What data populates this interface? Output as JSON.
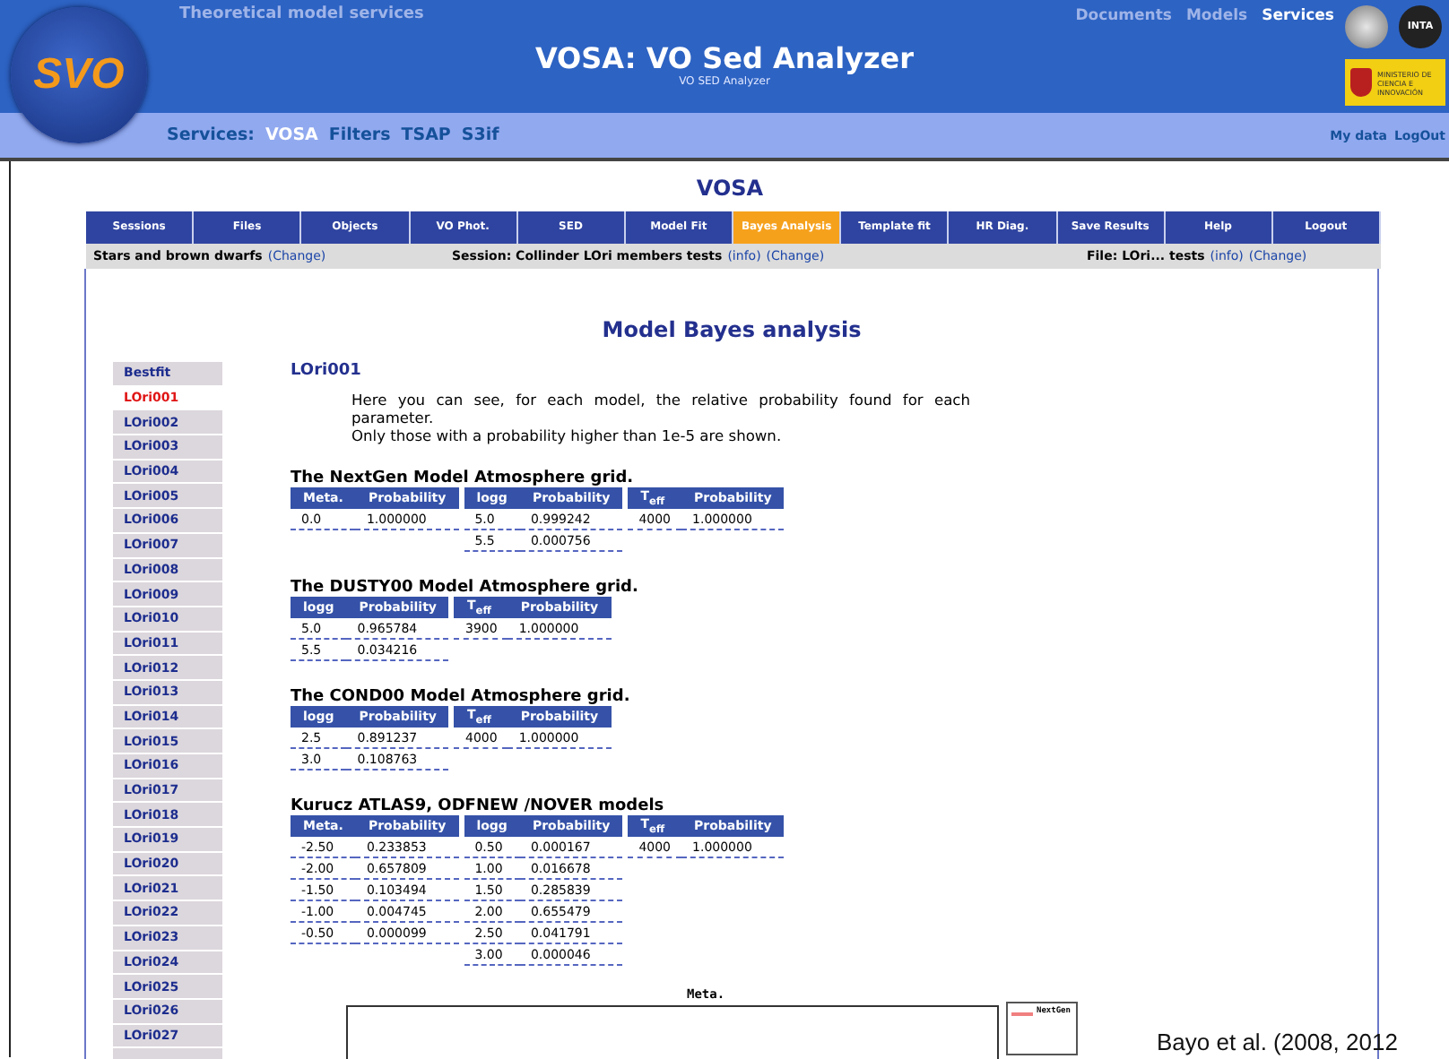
{
  "header": {
    "section_title": "Theoretical model services",
    "top_links": [
      {
        "label": "Documents",
        "selected": false
      },
      {
        "label": "Models",
        "selected": false
      },
      {
        "label": "Services",
        "selected": true
      }
    ],
    "title": "VOSA: VO Sed Analyzer",
    "subtitle": "VO SED Analyzer",
    "logo": "SVO",
    "partner_logo": "INTA",
    "ministry": "MINISTERIO DE CIENCIA E INNOVACIÓN"
  },
  "services_bar": {
    "label": "Services:",
    "links": [
      {
        "label": "VOSA",
        "selected": true
      },
      {
        "label": "Filters",
        "selected": false
      },
      {
        "label": "TSAP",
        "selected": false
      },
      {
        "label": "S3if",
        "selected": false
      }
    ],
    "user_links": [
      "My data",
      "LogOut"
    ]
  },
  "app_title": "VOSA",
  "tabs": [
    {
      "label": "Sessions",
      "selected": false
    },
    {
      "label": "Files",
      "selected": false
    },
    {
      "label": "Objects",
      "selected": false
    },
    {
      "label": "VO Phot.",
      "selected": false
    },
    {
      "label": "SED",
      "selected": false
    },
    {
      "label": "Model Fit",
      "selected": false
    },
    {
      "label": "Bayes Analysis",
      "selected": true
    },
    {
      "label": "Template fit",
      "selected": false
    },
    {
      "label": "HR Diag.",
      "selected": false
    },
    {
      "label": "Save Results",
      "selected": false
    },
    {
      "label": "Help",
      "selected": false
    },
    {
      "label": "Logout",
      "selected": false
    }
  ],
  "info_bar": [
    {
      "text": "Stars and brown dwarfs",
      "links": [
        "(Change)"
      ]
    },
    {
      "text": "Session: Collinder LOri members tests",
      "links": [
        "(info)",
        "(Change)"
      ]
    },
    {
      "text": "File: LOri... tests",
      "links": [
        "(info)",
        "(Change)"
      ]
    }
  ],
  "page_title": "Model Bayes analysis",
  "objects": [
    {
      "label": "Bestfit",
      "selected": false
    },
    {
      "label": "LOri001",
      "selected": true
    },
    {
      "label": "LOri002",
      "selected": false
    },
    {
      "label": "LOri003",
      "selected": false
    },
    {
      "label": "LOri004",
      "selected": false
    },
    {
      "label": "LOri005",
      "selected": false
    },
    {
      "label": "LOri006",
      "selected": false
    },
    {
      "label": "LOri007",
      "selected": false
    },
    {
      "label": "LOri008",
      "selected": false
    },
    {
      "label": "LOri009",
      "selected": false
    },
    {
      "label": "LOri010",
      "selected": false
    },
    {
      "label": "LOri011",
      "selected": false
    },
    {
      "label": "LOri012",
      "selected": false
    },
    {
      "label": "LOri013",
      "selected": false
    },
    {
      "label": "LOri014",
      "selected": false
    },
    {
      "label": "LOri015",
      "selected": false
    },
    {
      "label": "LOri016",
      "selected": false
    },
    {
      "label": "LOri017",
      "selected": false
    },
    {
      "label": "LOri018",
      "selected": false
    },
    {
      "label": "LOri019",
      "selected": false
    },
    {
      "label": "LOri020",
      "selected": false
    },
    {
      "label": "LOri021",
      "selected": false
    },
    {
      "label": "LOri022",
      "selected": false
    },
    {
      "label": "LOri023",
      "selected": false
    },
    {
      "label": "LOri024",
      "selected": false
    },
    {
      "label": "LOri025",
      "selected": false
    },
    {
      "label": "LOri026",
      "selected": false
    },
    {
      "label": "LOri027",
      "selected": false
    }
  ],
  "object_title": "LOri001",
  "intro": [
    "Here you can see, for each model, the relative probability found for each parameter.",
    "Only those with a probability higher than 1e-5 are shown."
  ],
  "models": [
    {
      "title": "The NextGen Model Atmosphere grid.",
      "tables": [
        {
          "columns": [
            "Meta.",
            "Probability"
          ],
          "rows": [
            [
              "0.0",
              "1.000000"
            ]
          ]
        },
        {
          "columns": [
            "logg",
            "Probability"
          ],
          "rows": [
            [
              "5.0",
              "0.999242"
            ],
            [
              "5.5",
              "0.000756"
            ]
          ]
        },
        {
          "columns": [
            "T$_{eff}$",
            "Probability"
          ],
          "rows": [
            [
              "4000",
              "1.000000"
            ]
          ]
        }
      ]
    },
    {
      "title": "The DUSTY00 Model Atmosphere grid.",
      "tables": [
        {
          "columns": [
            "logg",
            "Probability"
          ],
          "rows": [
            [
              "5.0",
              "0.965784"
            ],
            [
              "5.5",
              "0.034216"
            ]
          ]
        },
        {
          "columns": [
            "T$_{eff}$",
            "Probability"
          ],
          "rows": [
            [
              "3900",
              "1.000000"
            ]
          ]
        }
      ]
    },
    {
      "title": "The COND00 Model Atmosphere grid.",
      "tables": [
        {
          "columns": [
            "logg",
            "Probability"
          ],
          "rows": [
            [
              "2.5",
              "0.891237"
            ],
            [
              "3.0",
              "0.108763"
            ]
          ]
        },
        {
          "columns": [
            "T$_{eff}$",
            "Probability"
          ],
          "rows": [
            [
              "4000",
              "1.000000"
            ]
          ]
        }
      ]
    },
    {
      "title": "Kurucz ATLAS9, ODFNEW /NOVER models",
      "tables": [
        {
          "columns": [
            "Meta.",
            "Probability"
          ],
          "rows": [
            [
              "-2.50",
              "0.233853"
            ],
            [
              "-2.00",
              "0.657809"
            ],
            [
              "-1.50",
              "0.103494"
            ],
            [
              "-1.00",
              "0.004745"
            ],
            [
              "-0.50",
              "0.000099"
            ]
          ]
        },
        {
          "columns": [
            "logg",
            "Probability"
          ],
          "rows": [
            [
              "0.50",
              "0.000167"
            ],
            [
              "1.00",
              "0.016678"
            ],
            [
              "1.50",
              "0.285839"
            ],
            [
              "2.00",
              "0.655479"
            ],
            [
              "2.50",
              "0.041791"
            ],
            [
              "3.00",
              "0.000046"
            ]
          ]
        },
        {
          "columns": [
            "T$_{eff}$",
            "Probability"
          ],
          "rows": [
            [
              "4000",
              "1.000000"
            ]
          ]
        }
      ]
    }
  ],
  "plot": {
    "title": "Meta.",
    "legend": "NextGen"
  },
  "caption": "Bayo et al. (2008, 2012"
}
